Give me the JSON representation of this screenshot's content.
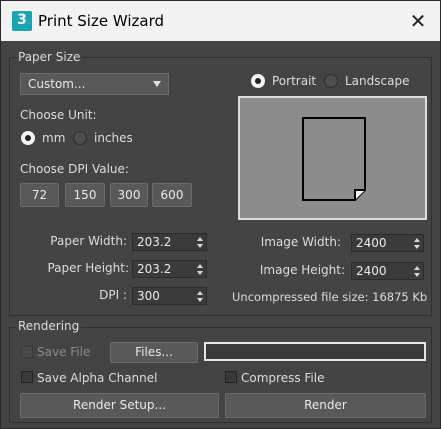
{
  "window": {
    "title": "Print Size Wizard",
    "app_icon_text": "3",
    "close_glyph": "✕"
  },
  "paper_size": {
    "group_label": "Paper Size",
    "preset_value": "Custom...",
    "orientation": {
      "portrait_label": "Portrait",
      "landscape_label": "Landscape",
      "selected": "portrait"
    },
    "unit": {
      "label": "Choose Unit:",
      "mm_label": "mm",
      "inches_label": "inches",
      "selected": "mm"
    },
    "dpi_presets": {
      "label": "Choose DPI Value:",
      "values": [
        "72",
        "150",
        "300",
        "600"
      ]
    },
    "fields": {
      "paper_width_label": "Paper Width:",
      "paper_width_value": "203.2",
      "paper_height_label": "Paper Height:",
      "paper_height_value": "203.2",
      "dpi_label": "DPI :",
      "dpi_value": "300",
      "image_width_label": "Image Width:",
      "image_width_value": "2400",
      "image_height_label": "Image Height:",
      "image_height_value": "2400",
      "uncompressed_size_text": "Uncompressed file size: 16875 Kb"
    }
  },
  "rendering": {
    "group_label": "Rendering",
    "save_file_label": "Save File",
    "save_file_checked": false,
    "files_button_label": "Files...",
    "file_path_value": "",
    "save_alpha_label": "Save Alpha Channel",
    "save_alpha_checked": false,
    "compress_file_label": "Compress File",
    "compress_file_checked": false,
    "render_setup_label": "Render Setup...",
    "render_label": "Render"
  },
  "colors": {
    "dialog_bg": "#444444",
    "titlebar_bg": "#f2f2f2",
    "app_icon": "#1aa3b2",
    "preview_bg": "#8c8c8c"
  }
}
